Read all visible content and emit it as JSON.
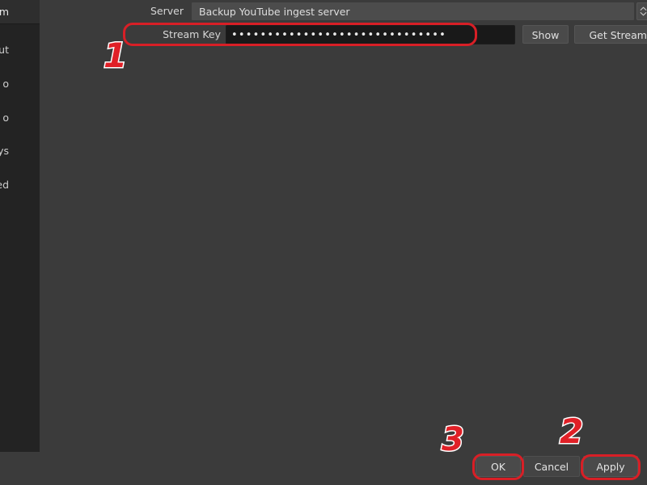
{
  "sidebar": {
    "items": [
      {
        "label": "Stream",
        "visible_text": "m",
        "selected": true
      },
      {
        "label": "Output",
        "visible_text": "ut",
        "selected": false
      },
      {
        "label": "Audio",
        "visible_text": "o",
        "selected": false
      },
      {
        "label": "Video",
        "visible_text": "o",
        "selected": false
      },
      {
        "label": "Hotkeys",
        "visible_text": "eys",
        "selected": false
      },
      {
        "label": "Advanced",
        "visible_text": "nced",
        "selected": false
      }
    ]
  },
  "form": {
    "server": {
      "label": "Server",
      "value": "Backup YouTube ingest server",
      "spinner_icon": "spinner-up-down-icon"
    },
    "stream_key": {
      "label": "Stream Key",
      "masked_value": "••••••••••••••••••••••••••••••",
      "show_button": "Show",
      "get_key_button": "Get Stream Key"
    }
  },
  "buttons": {
    "ok": "OK",
    "cancel": "Cancel",
    "apply": "Apply"
  },
  "annotations": {
    "one": "1",
    "two": "2",
    "three": "3"
  },
  "bottom_ghost_text": "",
  "colors": {
    "background": "#3b3b3b",
    "sidebar": "#232323",
    "sidebar_selected": "#2e2e2e",
    "field_dark": "#191919",
    "combo": "#4c4c4c",
    "button": "#4a4a4a",
    "annotation_red": "#d81f26",
    "text": "#d8d8d8"
  }
}
